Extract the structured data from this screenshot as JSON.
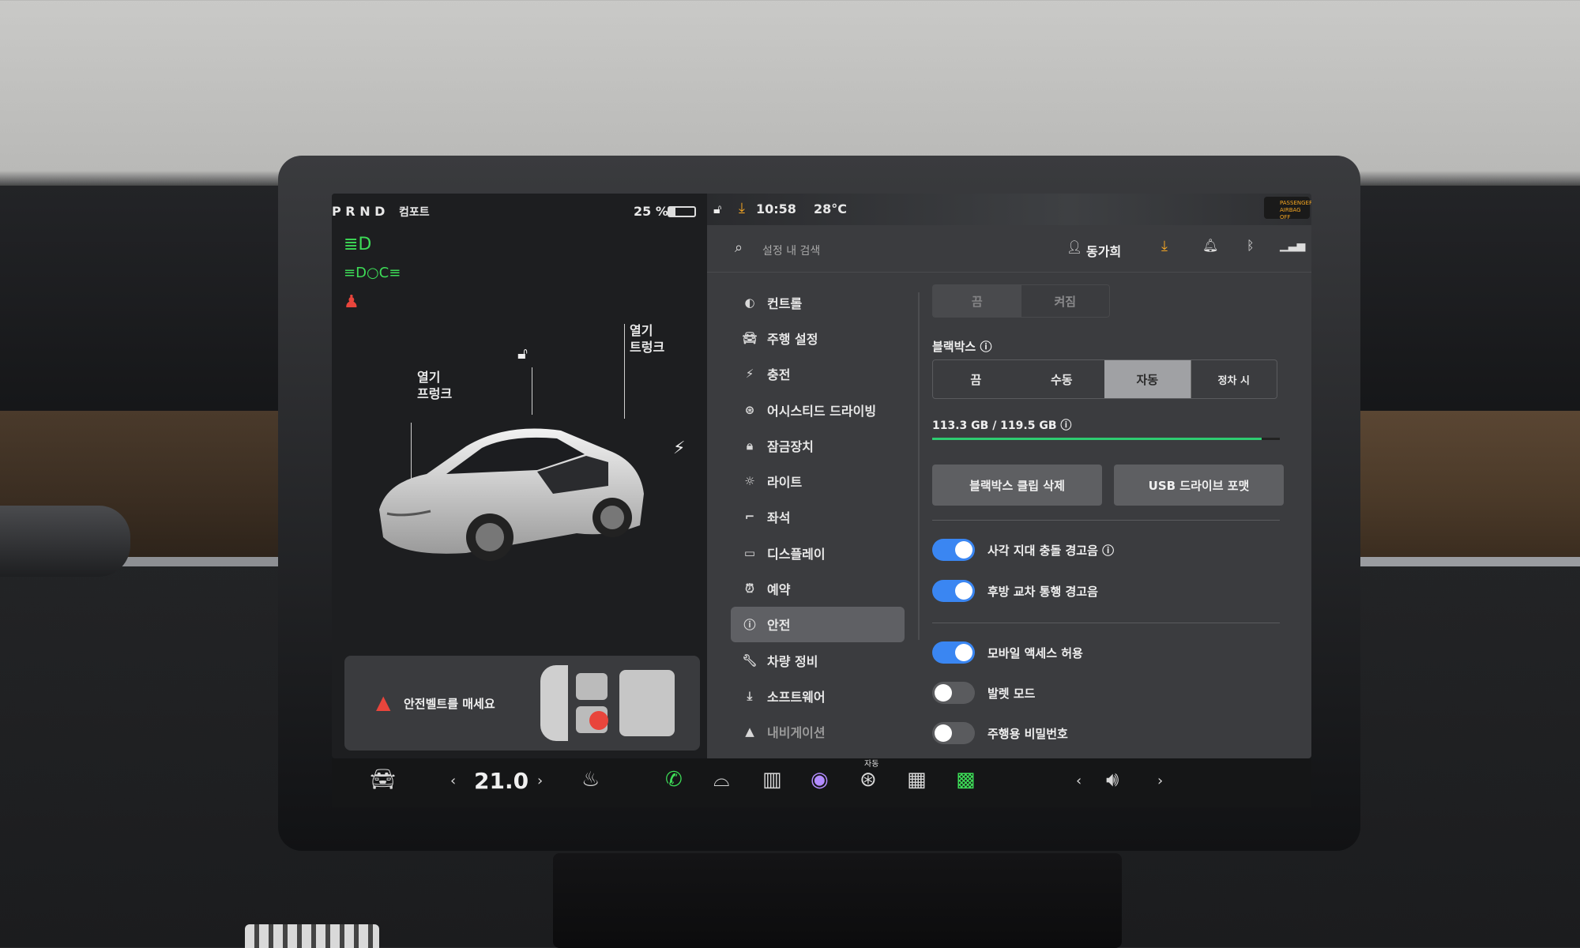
{
  "status_bar": {
    "gear": "P R N D",
    "drive_mode": "컴포트",
    "battery": "25 %",
    "time": "10:58",
    "temperature": "28°C",
    "airbag": "PASSENGER AIRBAG OFF"
  },
  "vehicle_view": {
    "frunk_label": "열기\n프렁크",
    "trunk_label": "열기\n트렁크",
    "seatbelt_alert": "안전벨트를 매세요"
  },
  "settings": {
    "search_placeholder": "설정 내 검색",
    "user_name": "동가희",
    "menu": [
      {
        "label": "컨트롤",
        "icon": "toggle-icon"
      },
      {
        "label": "주행 설정",
        "icon": "car-icon"
      },
      {
        "label": "충전",
        "icon": "bolt-icon"
      },
      {
        "label": "어시스티드 드라이빙",
        "icon": "steering-wheel-icon"
      },
      {
        "label": "잠금장치",
        "icon": "lock-icon"
      },
      {
        "label": "라이트",
        "icon": "sun-icon"
      },
      {
        "label": "좌석",
        "icon": "seat-icon"
      },
      {
        "label": "디스플레이",
        "icon": "display-icon"
      },
      {
        "label": "예약",
        "icon": "alarm-icon"
      },
      {
        "label": "안전",
        "icon": "info-icon"
      },
      {
        "label": "차량 정비",
        "icon": "wrench-icon"
      },
      {
        "label": "소프트웨어",
        "icon": "download-icon"
      },
      {
        "label": "내비게이션",
        "icon": "navigation-icon"
      }
    ],
    "active_menu": "안전",
    "top_segment": {
      "options": [
        "끔",
        "켜짐"
      ]
    },
    "dashcam": {
      "title": "블랙박스",
      "options": [
        "끔",
        "수동",
        "자동",
        "정차 시"
      ],
      "selected": "자동",
      "storage_text": "113.3 GB / 119.5 GB",
      "storage_used_fraction": 0.948,
      "delete_button": "블랙박스 클립 삭제",
      "format_button": "USB 드라이브 포맷"
    },
    "toggles": [
      {
        "label": "사각 지대 충돌 경고음",
        "on": true
      },
      {
        "label": "후방 교차 통행 경고음",
        "on": true
      },
      {
        "label": "모바일 액세스 허용",
        "on": true
      },
      {
        "label": "발렛 모드",
        "on": false
      },
      {
        "label": "주행용 비밀번호",
        "on": false
      }
    ]
  },
  "dock": {
    "temperature": "21.0",
    "auto_label": "자동"
  },
  "colors": {
    "toggle_on": "#3a86f2",
    "storage_bar": "#2ecc71",
    "indicator_green": "#3ddc57",
    "warning_red": "#e8453c"
  }
}
